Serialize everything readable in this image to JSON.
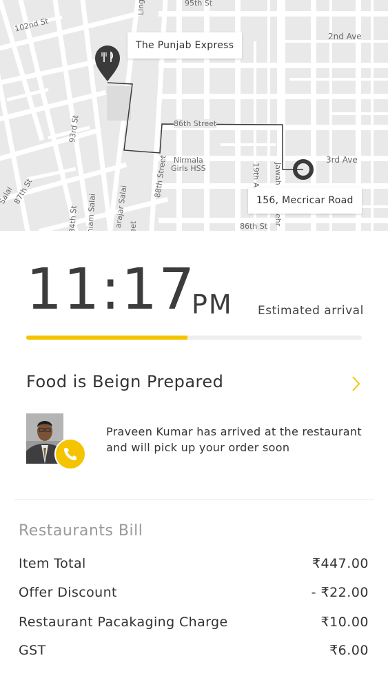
{
  "map": {
    "streets": {
      "s95th": "95th St",
      "s102nd": "102nd St",
      "ling": "Ling",
      "ave2nd": "2nd Ave",
      "s93rd": "93rd St",
      "s86th_street": "86th Street",
      "nirmala": "Nirmala\nGirls HSS",
      "ave3rd": "3rd Ave",
      "s19th": "19th Av",
      "jawah": "Jawah",
      "s87th": "87th St",
      "salai_left": "Salai",
      "s88th": "88th Street",
      "arajar": "arajar Salai",
      "niam": "niam Salai",
      "s84th": "84th St",
      "eet": "eet",
      "s86th_st": "86th St",
      "nehr": "ehr"
    },
    "restaurant_tag": "The Punjab Express",
    "destination_tag": "156, Mecricar Road"
  },
  "eta": {
    "time": "11:17",
    "ampm": "PM",
    "label": "Estimated arrival",
    "progress": 0.48
  },
  "status": {
    "title": "Food is Beign Prepared"
  },
  "driver": {
    "message": "Praveen Kumar has arrived at the restaurant and will pick up your order soon"
  },
  "bill": {
    "title": "Restaurants Bill",
    "rows": [
      {
        "label": "Item Total",
        "value": "₹447.00"
      },
      {
        "label": "Offer Discount",
        "value": "- ₹22.00"
      },
      {
        "label": "Restaurant Pacakaging Charge",
        "value": "₹10.00"
      },
      {
        "label": "GST",
        "value": "₹6.00"
      }
    ]
  },
  "colors": {
    "accent": "#f5c400",
    "map_bg": "#e9e9e9",
    "route": "#3a3a3a"
  },
  "icons": {
    "restaurant_pin": "fork-knife-pin-icon",
    "destination": "destination-ring-icon",
    "chevron": "chevron-right-icon",
    "call": "phone-icon"
  }
}
